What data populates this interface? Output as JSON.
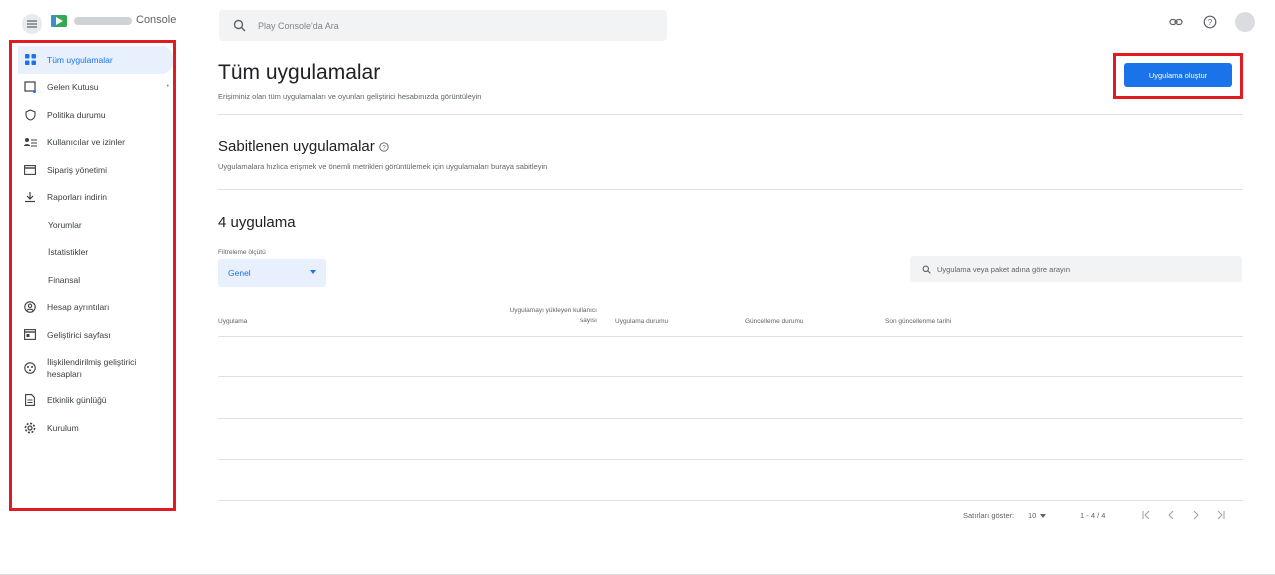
{
  "header": {
    "brand_suffix": "Console",
    "search_placeholder": "Play Console'da Ara"
  },
  "sidebar": {
    "items": [
      {
        "label": "Tüm uygulamalar",
        "icon": "apps-grid-icon",
        "active": true
      },
      {
        "label": "Gelen Kutusu",
        "icon": "inbox-icon",
        "badge": "•"
      },
      {
        "label": "Politika durumu",
        "icon": "shield-icon"
      },
      {
        "label": "Kullanıcılar ve izinler",
        "icon": "users-permissions-icon"
      },
      {
        "label": "Sipariş yönetimi",
        "icon": "credit-card-icon"
      },
      {
        "label": "Raporları indirin",
        "icon": "download-icon"
      },
      {
        "label": "Yorumlar",
        "icon": ""
      },
      {
        "label": "İstatistikler",
        "icon": ""
      },
      {
        "label": "Finansal",
        "icon": ""
      },
      {
        "label": "Hesap ayrıntıları",
        "icon": "account-circle-icon"
      },
      {
        "label": "Geliştirici sayfası",
        "icon": "web-page-icon"
      },
      {
        "label": "İlişkilendirilmiş geliştirici hesapları",
        "icon": "linked-accounts-icon"
      },
      {
        "label": "Etkinlik günlüğü",
        "icon": "document-icon"
      },
      {
        "label": "Kurulum",
        "icon": "gear-icon"
      }
    ]
  },
  "main": {
    "title": "Tüm uygulamalar",
    "subtitle": "Erişiminiz olan tüm uygulamaları ve oyunları geliştirici hesabınızda görüntüleyin",
    "create_button": "Uygulama oluştur",
    "pinned_title": "Sabitlenen uygulamalar",
    "pinned_subtitle": "Uygulamalara hızlıca erişmek ve önemli metrikleri görüntülemek için uygulamaları buraya sabitleyin",
    "count_title": "4 uygulama",
    "filter_label": "Filtreleme ölçütü",
    "filter_value": "Genel",
    "app_search_placeholder": "Uygulama veya paket adına göre arayın",
    "table": {
      "col_app": "Uygulama",
      "col_installs_line1": "Uygulamayı yükleyen kullanıcı",
      "col_installs_line2": "sayısı",
      "col_status": "Uygulama durumu",
      "col_update_status": "Güncelleme durumu",
      "col_last_update": "Son güncellenme tarihi"
    },
    "pagination": {
      "rows_label": "Satırları göster:",
      "rows_value": "10",
      "range": "1 - 4 / 4"
    }
  },
  "colors": {
    "accent": "#1a73e8",
    "highlight": "#e11b22",
    "active_bg": "#e8f0fe"
  }
}
